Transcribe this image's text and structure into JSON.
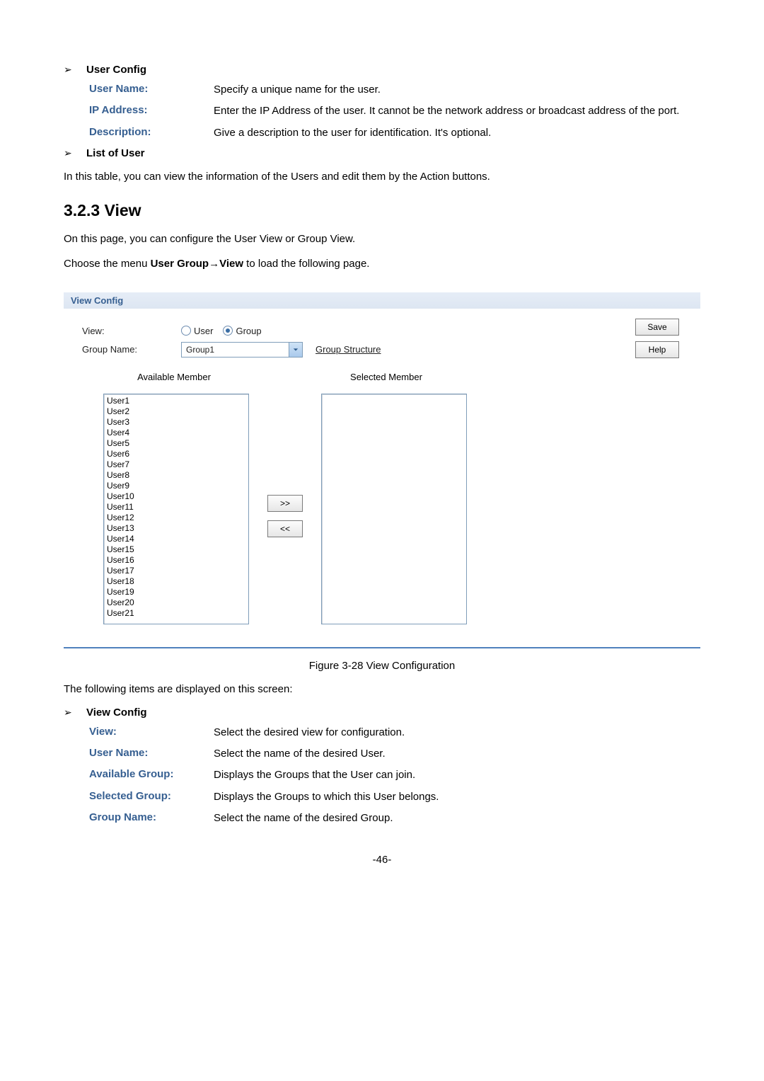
{
  "section1": {
    "title": "User Config",
    "rows": [
      {
        "label": "User Name:",
        "desc": "Specify a unique name for the user."
      },
      {
        "label": "IP Address:",
        "desc": "Enter the IP Address of the user. It cannot be the network address or broadcast address of the port."
      },
      {
        "label": "Description:",
        "desc": "Give a description to the user for identification. It's optional."
      }
    ]
  },
  "section2": {
    "title": "List of User",
    "para": "In this table, you can view the information of the Users and edit them by the Action buttons."
  },
  "heading": "3.2.3   View",
  "para1": "On this page, you can configure the User View or Group View.",
  "para2_a": "Choose the menu ",
  "para2_b": "User Group→View",
  "para2_c": " to load the following page.",
  "panel": {
    "title": "View Config",
    "view_label": "View:",
    "radio_user": "User",
    "radio_group": "Group",
    "groupname_label": "Group Name:",
    "groupname_value": "Group1",
    "group_structure": "Group Structure",
    "save": "Save",
    "help": "Help",
    "available_header": "Available Member",
    "selected_header": "Selected Member",
    "move_right": ">>",
    "move_left": "<<",
    "available_list": [
      "User1",
      "User2",
      "User3",
      "User4",
      "User5",
      "User6",
      "User7",
      "User8",
      "User9",
      "User10",
      "User11",
      "User12",
      "User13",
      "User14",
      "User15",
      "User16",
      "User17",
      "User18",
      "User19",
      "User20",
      "User21"
    ],
    "selected_list": []
  },
  "fig_caption": "Figure 3-28 View Configuration",
  "para3": "The following items are displayed on this screen:",
  "section3": {
    "title": "View Config",
    "rows": [
      {
        "label": "View:",
        "desc": "Select the desired view for configuration."
      },
      {
        "label": "User Name:",
        "desc": "Select the name of the desired User."
      },
      {
        "label": "Available Group:",
        "desc": "Displays the Groups that the User can join."
      },
      {
        "label": "Selected Group:",
        "desc": "Displays the Groups to which this User belongs."
      },
      {
        "label": "Group Name:",
        "desc": "Select the name of the desired Group."
      }
    ]
  },
  "page_number": "-46-"
}
